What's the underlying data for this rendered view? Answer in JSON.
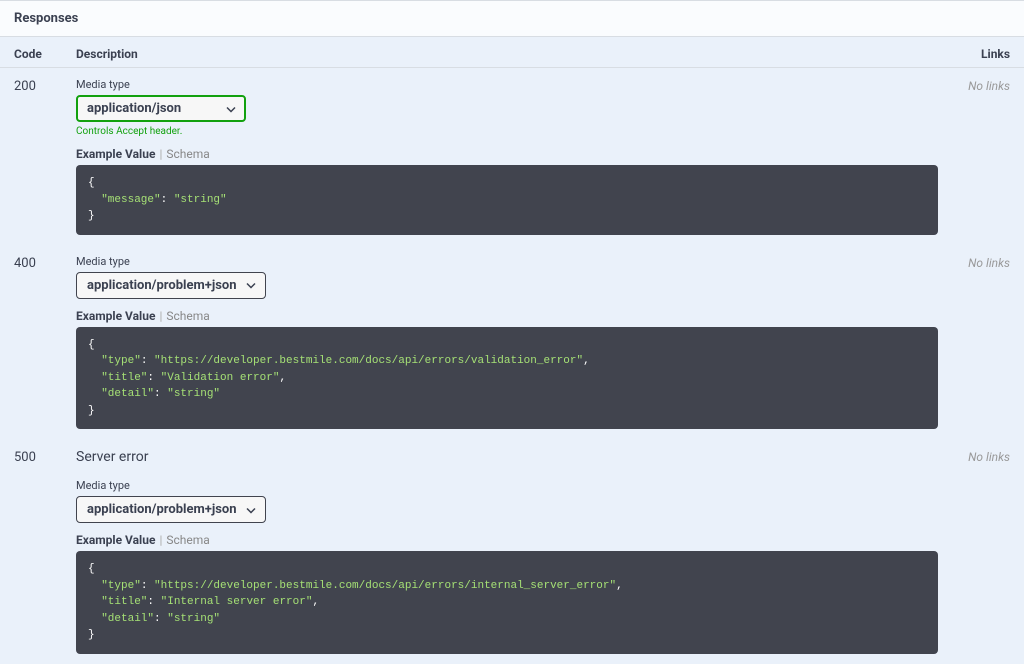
{
  "section_title": "Responses",
  "columns": {
    "code": "Code",
    "description": "Description",
    "links": "Links"
  },
  "no_links": "No links",
  "media_type_label": "Media type",
  "accept_note": "Controls Accept header.",
  "tabs": {
    "example": "Example Value",
    "schema": "Schema"
  },
  "responses": [
    {
      "code": "200",
      "description": "",
      "media_type": "application/json",
      "focused": true,
      "example": "{\n  \"message\": \"string\"\n}"
    },
    {
      "code": "400",
      "description": "",
      "media_type": "application/problem+json",
      "focused": false,
      "example": "{\n  \"type\": \"https://developer.bestmile.com/docs/api/errors/validation_error\",\n  \"title\": \"Validation error\",\n  \"detail\": \"string\"\n}"
    },
    {
      "code": "500",
      "description": "Server error",
      "media_type": "application/problem+json",
      "focused": false,
      "example": "{\n  \"type\": \"https://developer.bestmile.com/docs/api/errors/internal_server_error\",\n  \"title\": \"Internal server error\",\n  \"detail\": \"string\"\n}"
    }
  ]
}
